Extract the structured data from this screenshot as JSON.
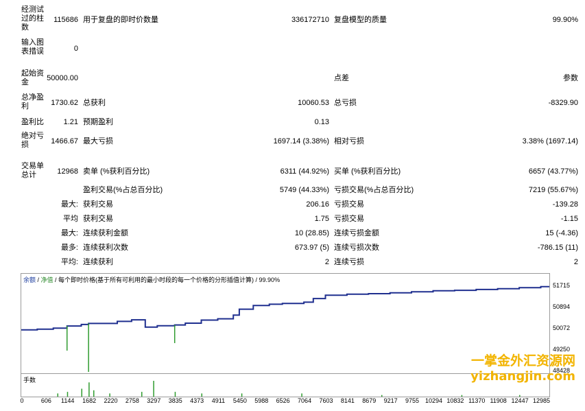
{
  "report": {
    "bars_label": "经测试过的柱数",
    "bars_value": "115686",
    "ticks_label": "用于复盘的即时价数量",
    "ticks_value": "336172710",
    "quality_label": "复盘模型的质量",
    "quality_value": "99.90%",
    "mismatch_label": "输入图表措误",
    "mismatch_value": "0",
    "deposit_label": "起始资金",
    "deposit_value": "50000.00",
    "spread_label": "点差",
    "params_label": "参数",
    "net_profit_label": "总净盈利",
    "net_profit_value": "1730.62",
    "gross_profit_label": "总获利",
    "gross_profit_value": "10060.53",
    "gross_loss_label": "总亏损",
    "gross_loss_value": "-8329.90",
    "profit_factor_label": "盈利比",
    "profit_factor_value": "1.21",
    "expected_payoff_label": "预期盈利",
    "expected_payoff_value": "0.13",
    "abs_drawdown_label": "绝对亏损",
    "abs_drawdown_value": "1466.67",
    "max_drawdown_label": "最大亏损",
    "max_drawdown_value": "1697.14 (3.38%)",
    "rel_drawdown_label": "相对亏损",
    "rel_drawdown_value": "3.38% (1697.14)",
    "total_trades_label": "交易单总计",
    "total_trades_value": "12968",
    "short_label": "卖单 (%获利百分比)",
    "short_value": "6311 (44.92%)",
    "long_label": "买单 (%获利百分比)",
    "long_value": "6657 (43.77%)",
    "profit_trades_label": "盈利交易(%占总百分比)",
    "profit_trades_value": "5749 (44.33%)",
    "loss_trades_label": "亏损交易(%占总百分比)",
    "loss_trades_value": "7219 (55.67%)",
    "rows": [
      {
        "prefix": "最大:",
        "left_label": "获利交易",
        "left_value": "206.16",
        "right_label": "亏损交易",
        "right_value": "-139.28"
      },
      {
        "prefix": "平均",
        "left_label": "获利交易",
        "left_value": "1.75",
        "right_label": "亏损交易",
        "right_value": "-1.15"
      },
      {
        "prefix": "最大:",
        "left_label": "连续获利金额",
        "left_value": "10 (28.85)",
        "right_label": "连续亏损金额",
        "right_value": "15 (-4.36)"
      },
      {
        "prefix": "最多:",
        "left_label": "连续获利次数",
        "left_value": "673.97 (5)",
        "right_label": "连续亏损次数",
        "right_value": "-786.15 (11)"
      },
      {
        "prefix": "平均:",
        "left_label": "连续获利",
        "left_value": "2",
        "right_label": "连续亏损",
        "right_value": "2"
      }
    ]
  },
  "chart": {
    "legend_balance": "余额",
    "legend_sep1": " / ",
    "legend_equity": "净值",
    "legend_rest": " / 每个即时价格(基于所有可利用的最小时段的每一个价格的分形插值计算) / 99.90%",
    "volume_label": "手数",
    "balance_color": "#1f2f8f",
    "equity_color": "#2e9b2e"
  },
  "chart_data": {
    "type": "line",
    "title": "",
    "xlabel": "",
    "ylabel": "",
    "ylim": [
      48428,
      51900
    ],
    "x_ticks": [
      "0",
      "606",
      "1144",
      "1682",
      "2220",
      "2758",
      "3297",
      "3835",
      "4373",
      "4911",
      "5450",
      "5988",
      "6526",
      "7064",
      "7603",
      "8141",
      "8679",
      "9217",
      "9755",
      "10294",
      "10832",
      "11370",
      "11908",
      "12447",
      "12985"
    ],
    "y_ticks": [
      "51715",
      "50894",
      "50072",
      "49250",
      "48428"
    ],
    "series": [
      {
        "name": "余额",
        "x": [
          0,
          400,
          800,
          1144,
          1500,
          1682,
          2000,
          2400,
          2758,
          3100,
          3400,
          3835,
          4100,
          4500,
          4911,
          5300,
          5450,
          5800,
          6200,
          6526,
          7064,
          7300,
          7603,
          8141,
          8679,
          9217,
          9755,
          10294,
          10832,
          11370,
          11908,
          12447,
          12985,
          13200
        ],
        "values": [
          50050,
          50080,
          50120,
          50200,
          50260,
          50300,
          50300,
          50380,
          50440,
          50160,
          50210,
          50240,
          50310,
          50430,
          50480,
          50620,
          50850,
          50990,
          51040,
          51070,
          51120,
          51260,
          51390,
          51430,
          51450,
          51480,
          51520,
          51560,
          51580,
          51610,
          51640,
          51680,
          51720,
          51710
        ]
      },
      {
        "name": "净值",
        "x": [
          1144,
          1682,
          3835
        ],
        "values": [
          49250,
          48428,
          49540
        ]
      }
    ],
    "volume": {
      "name": "手数",
      "x": [
        900,
        1144,
        1500,
        1682,
        1800,
        2200,
        3000,
        3297,
        3835,
        4500,
        5500,
        7000,
        9000,
        11000,
        12447
      ],
      "values": [
        2,
        3,
        5,
        9,
        4,
        2,
        3,
        10,
        3,
        2,
        2,
        2,
        1,
        1,
        1
      ]
    }
  },
  "watermark": {
    "line1": "一掌金外汇资源网",
    "line2": "yizhangjin.com"
  }
}
